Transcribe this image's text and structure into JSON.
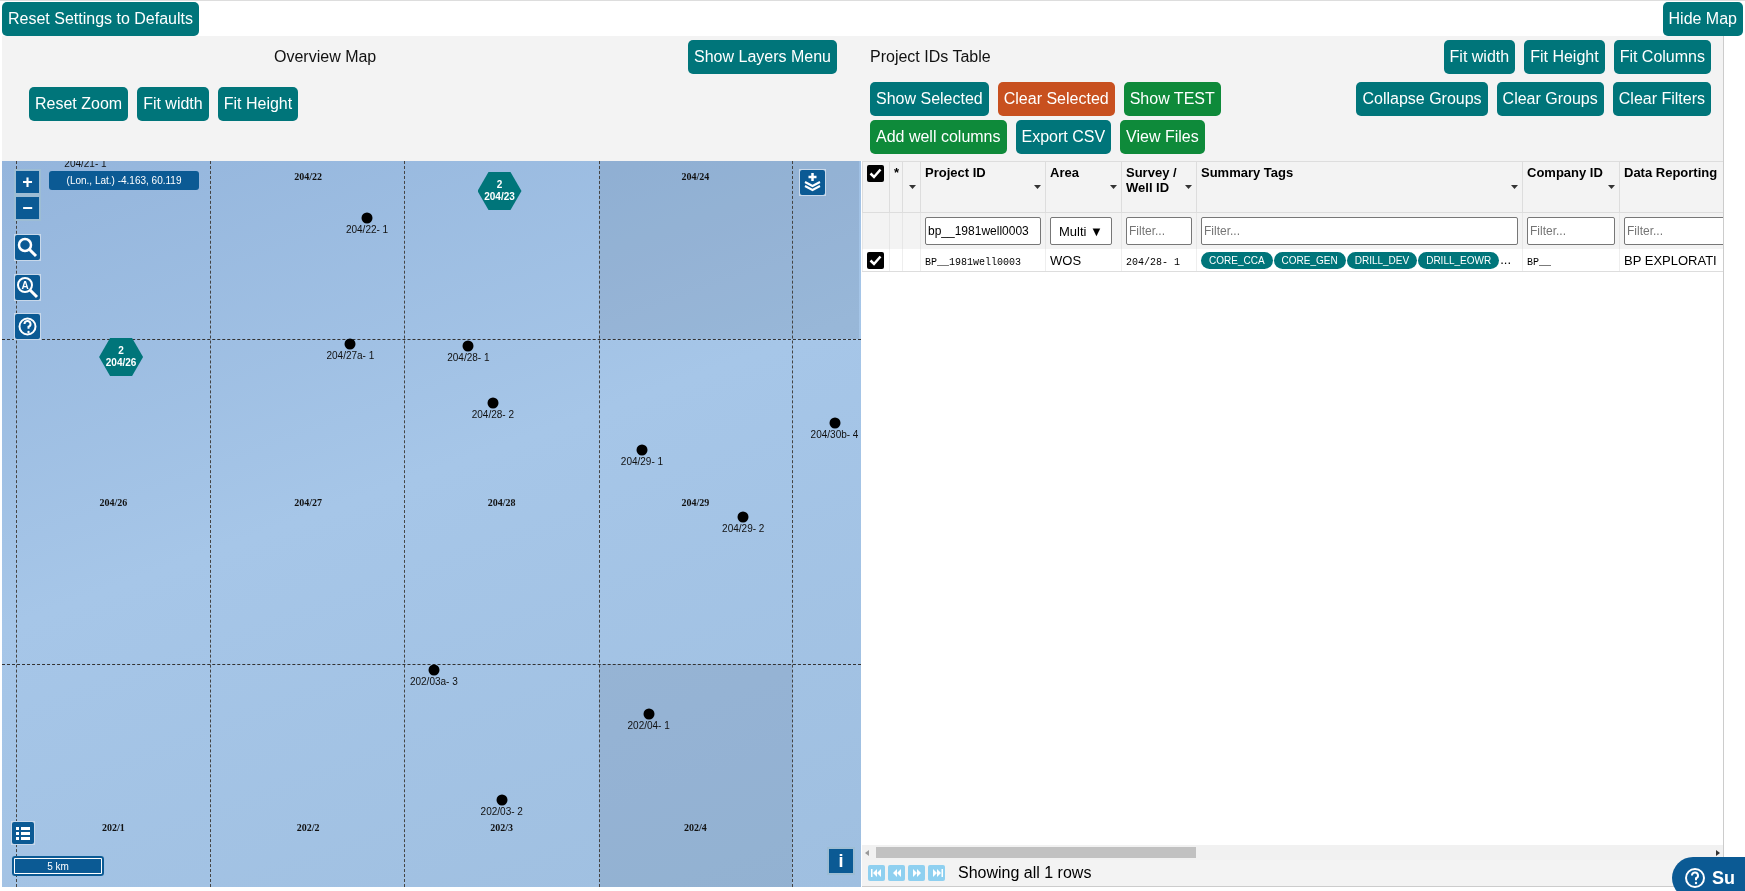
{
  "top_bar": {
    "reset_button": "Reset Settings to Defaults",
    "hide_map_button": "Hide Map"
  },
  "map_panel": {
    "title": "Overview Map",
    "layers_button": "Show Layers Menu",
    "buttons": [
      "Reset Zoom",
      "Fit width",
      "Fit Height"
    ],
    "map": {
      "coordinates": "(Lon., Lat.) -4.163, 60.119",
      "zoom_in": "+",
      "zoom_out": "−",
      "scale": "5 km",
      "info": "i",
      "zoom_extent_letter": "A",
      "blocks": [
        "204/22",
        "204/24",
        "204/26",
        "204/27",
        "204/28",
        "204/29",
        "202/1",
        "202/2",
        "202/3",
        "202/4"
      ],
      "wells": [
        "204/21- 1",
        "204/22- 1",
        "204/27a- 1",
        "204/28- 1",
        "204/28- 2",
        "204/29- 1",
        "204/29- 2",
        "204/30b- 4",
        "202/03a- 3",
        "202/04- 1",
        "202/03- 2"
      ],
      "clusters": [
        {
          "count": "2",
          "label": "204/23"
        },
        {
          "count": "2",
          "label": "204/26"
        }
      ]
    }
  },
  "table_panel": {
    "title": "Project IDs Table",
    "button_rows": [
      {
        "left": [],
        "right": [
          {
            "label": "Fit width",
            "color": "#00757a"
          },
          {
            "label": "Fit Height",
            "color": "#00757a"
          },
          {
            "label": "Fit Columns",
            "color": "#00757a"
          }
        ]
      },
      {
        "left": [
          {
            "label": "Show Selected",
            "color": "#00757a"
          },
          {
            "label": "Clear Selected",
            "color": "#c8501f"
          },
          {
            "label": "Show TEST",
            "color": "#0e8a3a"
          }
        ],
        "right": [
          {
            "label": "Collapse Groups",
            "color": "#00757a"
          },
          {
            "label": "Clear Groups",
            "color": "#00757a"
          },
          {
            "label": "Clear Filters",
            "color": "#00757a"
          }
        ]
      },
      {
        "left": [
          {
            "label": "Add well columns",
            "color": "#0e8a3a"
          },
          {
            "label": "Export CSV",
            "color": "#00757a"
          },
          {
            "label": "View Files",
            "color": "#0e8a3a"
          }
        ],
        "right": []
      }
    ],
    "table": {
      "select_all_checked": true,
      "star_header": "*",
      "columns": [
        {
          "label": "Project ID",
          "kind": "text",
          "filter_value": "bp__1981well0003"
        },
        {
          "label": "Area",
          "kind": "select",
          "filter_value": "Multi ▼"
        },
        {
          "label": "Survey / Well ID",
          "kind": "text",
          "placeholder": "Filter..."
        },
        {
          "label": "Summary Tags",
          "kind": "text",
          "placeholder": "Filter..."
        },
        {
          "label": "Company ID",
          "kind": "text",
          "placeholder": "Filter..."
        },
        {
          "label": "Data Reporting",
          "kind": "text",
          "placeholder": "Filter..."
        }
      ],
      "rows": [
        {
          "selected": true,
          "project_id": "BP__1981well0003",
          "area": "WOS",
          "well_id": "204/28- 1",
          "tags": [
            "CORE_CCA",
            "CORE_GEN",
            "DRILL_DEV",
            "DRILL_EOWR"
          ],
          "tags_more": "...",
          "company_id": "BP__",
          "data_reporting": "BP EXPLORATI"
        }
      ]
    },
    "footer": "Showing all 1 rows"
  },
  "support_button": "Su"
}
